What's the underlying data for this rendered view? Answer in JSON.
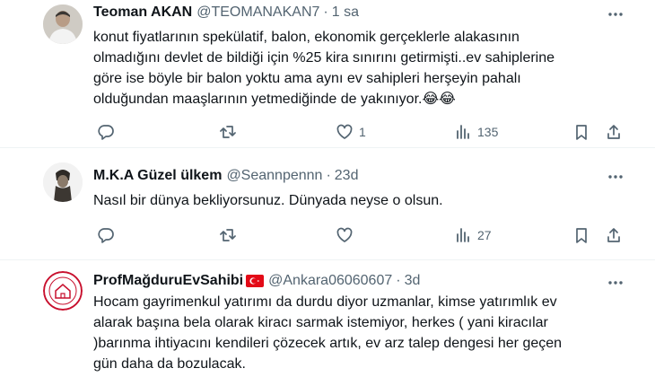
{
  "tweets": [
    {
      "name": "Teoman AKAN",
      "handle": "@TEOMANAKAN7",
      "separator": "·",
      "time": "1 sa",
      "text_lines": [
        "konut fiyatlarının spekülatif, balon, ekonomik gerçeklerle alakasının",
        "olmadığını devlet de bildiği için %25 kira sınırını getirmişti..ev sahiplerine",
        "göre ise böyle bir balon yoktu ama aynı ev sahipleri herşeyin pahalı",
        "olduğundan maaşlarının yetmediğinde  de yakınıyor.😂😂"
      ],
      "replies": "",
      "retweets": "",
      "likes": "1",
      "views": "135"
    },
    {
      "name": "M.K.A Güzel ülkem",
      "handle": "@Seannpennn",
      "separator": "·",
      "time": "23d",
      "text_lines": [
        "Nasıl bir dünya bekliyorsunuz. Dünyada neyse o olsun."
      ],
      "replies": "",
      "retweets": "",
      "likes": "",
      "views": "27"
    },
    {
      "name": "ProfMağduruEvSahibi",
      "handle": "@Ankara06060607",
      "separator": "·",
      "time": "3d",
      "text_lines": [
        "Hocam gayrimenkul yatırımı da durdu diyor uzmanlar, kimse yatırımlık ev",
        "alarak başına bela olarak kiracı sarmak istemiyor, herkes ( yani kiracılar",
        ")barınma ihtiyacını kendileri çözecek artık, ev arz talep dengesi her geçen",
        "gün daha da bozulacak."
      ]
    }
  ],
  "icons": {
    "reply": "reply-icon",
    "retweet": "retweet-icon",
    "like": "heart-icon",
    "views": "views-chart-icon",
    "bookmark": "bookmark-icon",
    "share": "share-icon",
    "more": "more-dots-icon",
    "flag": "turkey-flag-icon"
  },
  "colors": {
    "text": "#0f1419",
    "secondary": "#536471",
    "divider": "#eff3f4",
    "flag_red": "#e30a17"
  }
}
